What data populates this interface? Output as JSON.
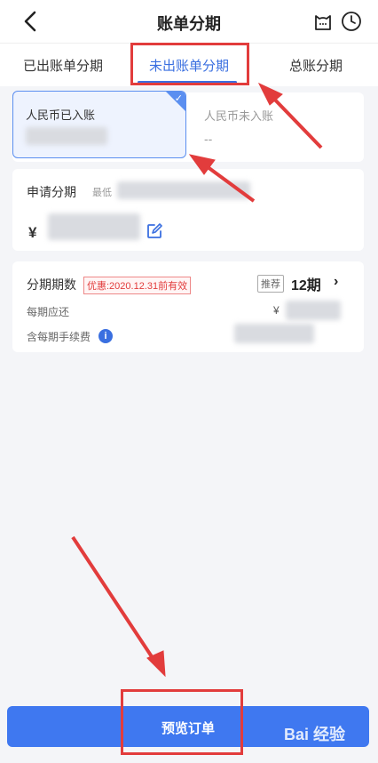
{
  "header": {
    "title": "账单分期"
  },
  "tabs": [
    {
      "label": "已出账单分期",
      "active": false
    },
    {
      "label": "未出账单分期",
      "active": true
    },
    {
      "label": "总账分期",
      "active": false
    }
  ],
  "account": {
    "billed_label": "人民币已入账",
    "unbilled_label": "人民币未入账",
    "unbilled_value": "--"
  },
  "apply": {
    "label": "申请分期",
    "min_label": "最低",
    "currency": "¥"
  },
  "installment": {
    "label": "分期期数",
    "promo": "优惠:2020.12.31前有效",
    "recommend_tag": "推荐",
    "period": "12期",
    "monthly_label": "每期应还",
    "monthly_currency": "¥",
    "fee_label": "含每期手续费",
    "info_glyph": "i"
  },
  "footer": {
    "button_label": "预览订单"
  },
  "watermark": "Bai 经验",
  "colors": {
    "accent": "#3a6fe0",
    "button": "#3f78f0",
    "highlight": "#e23c3c"
  }
}
